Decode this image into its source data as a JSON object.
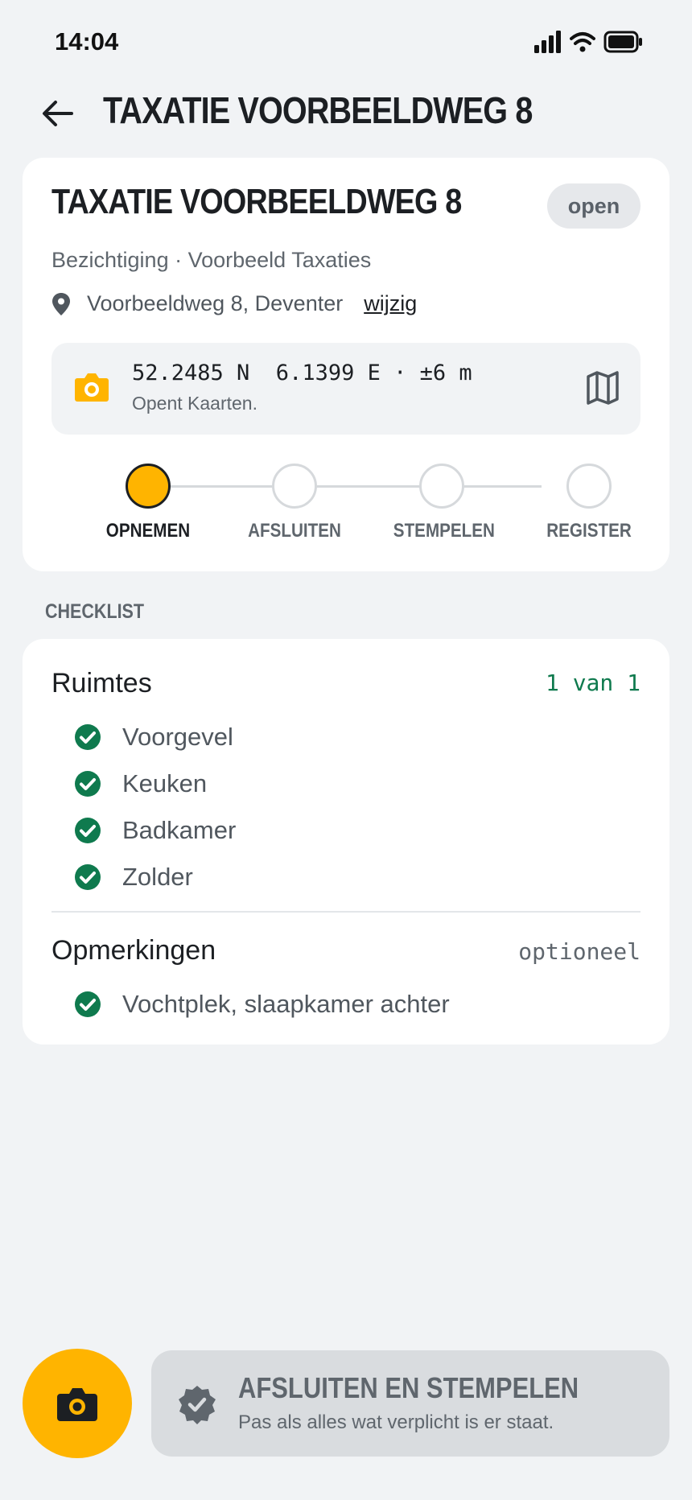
{
  "status_bar": {
    "time": "14:04"
  },
  "header": {
    "title": "TAXATIE VOORBEELDWEG 8",
    "back_icon": "arrow-left-icon"
  },
  "card": {
    "title": "TAXATIE VOORBEELDWEG 8",
    "badge": "open",
    "subtitle": "Bezichtiging · Voorbeeld Taxaties",
    "address": "Voorbeeldweg 8, Deventer",
    "edit_link": "wijzig",
    "gps": {
      "coords": "52.2485 N  6.1399 E · ±6 m",
      "note": "Opent Kaarten."
    },
    "steps": [
      {
        "label": "OPNEMEN",
        "active": true
      },
      {
        "label": "AFSLUITEN",
        "active": false
      },
      {
        "label": "STEMPELEN",
        "active": false
      },
      {
        "label": "REGISTER",
        "active": false
      }
    ]
  },
  "checklist": {
    "section_label": "CHECKLIST",
    "rooms": {
      "title": "Ruimtes",
      "meta": "1 van 1",
      "items": [
        "Voorgevel",
        "Keuken",
        "Badkamer",
        "Zolder"
      ]
    },
    "remarks": {
      "title": "Opmerkingen",
      "meta": "optioneel",
      "items": [
        "Vochtplek, slaapkamer achter"
      ]
    }
  },
  "bottom": {
    "action_title": "AFSLUITEN EN STEMPELEN",
    "action_sub": "Pas als alles wat verplicht is er staat."
  },
  "colors": {
    "accent": "#ffb400",
    "success": "#0f7a4e",
    "background": "#f1f3f5",
    "disabled": "#d9dcdf"
  }
}
